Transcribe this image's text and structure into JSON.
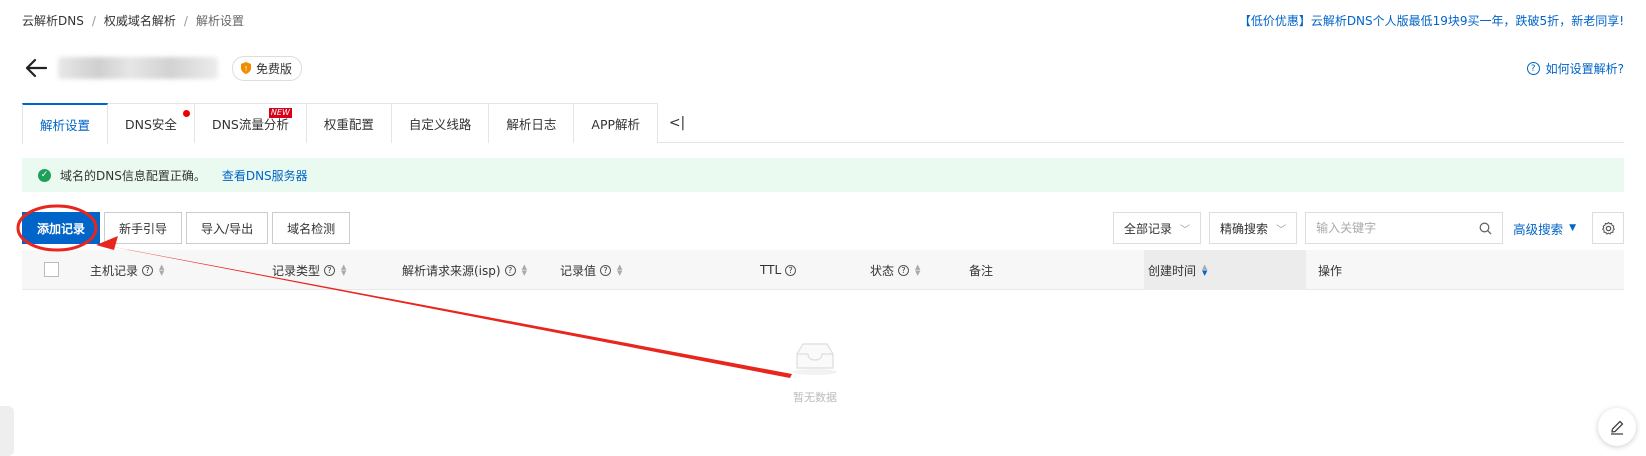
{
  "breadcrumb": {
    "items": [
      "云解析DNS",
      "权威域名解析",
      "解析设置"
    ]
  },
  "promo": "【低价优惠】云解析DNS个人版最低19块9买一年，跌破5折，新老同享!",
  "header": {
    "edition_badge": "免费版",
    "help_link": "如何设置解析?"
  },
  "tabs": [
    {
      "label": "解析设置",
      "active": true
    },
    {
      "label": "DNS安全",
      "dot": true
    },
    {
      "label": "DNS流量分析",
      "badge": "NEW"
    },
    {
      "label": "权重配置"
    },
    {
      "label": "自定义线路"
    },
    {
      "label": "解析日志"
    },
    {
      "label": "APP解析"
    }
  ],
  "tab_collapse": "<|",
  "notice": {
    "text": "域名的DNS信息配置正确。",
    "link": "查看DNS服务器",
    "color": "#1fa05a"
  },
  "toolbar": {
    "add_record": "添加记录",
    "beginner_guide": "新手引导",
    "import_export": "导入/导出",
    "domain_check": "域名检测",
    "record_filter": "全部记录",
    "search_mode": "精确搜索",
    "search_placeholder": "输入关键字",
    "advanced_search": "高级搜索"
  },
  "table": {
    "columns": [
      "主机记录",
      "记录类型",
      "解析请求来源(isp)",
      "记录值",
      "TTL",
      "状态",
      "备注",
      "创建时间",
      "操作"
    ]
  },
  "empty_text": "暂无数据",
  "colors": {
    "primary": "#0064c8",
    "annotation": "#e8261e"
  }
}
